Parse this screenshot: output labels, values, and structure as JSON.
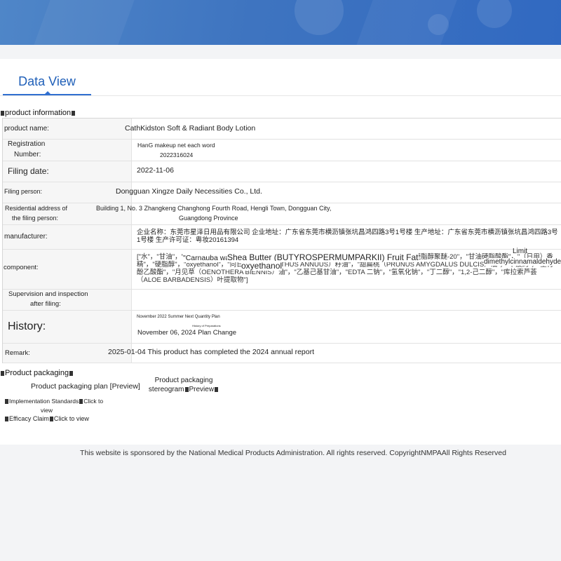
{
  "tab": {
    "label": "Data View"
  },
  "product_information": {
    "section_title": "product information",
    "fields": {
      "product_name": {
        "label": "product name:",
        "value": "CathKidston Soft & Radiant Body Lotion"
      },
      "registration_number": {
        "label_line1": "Registration",
        "label_line2": "Number:",
        "value_line1": "HanG makeup net each word",
        "value_line2": "2022316024"
      },
      "filing_date": {
        "label": "Filing date:",
        "value": "2022-11-06"
      },
      "filing_person": {
        "label": "Filing person:",
        "value": "Dongguan Xingze Daily Necessities Co., Ltd."
      },
      "residential_address": {
        "label_line1": "Residential address of",
        "label_line2": "the filing person:",
        "value_line1": "Building 1, No. 3 Zhangkeng Changhong Fourth Road, Hengli Town, Dongguan City,",
        "value_line2": "Guangdong Province"
      },
      "manufacturer": {
        "label": "manufacturer:",
        "value": "企业名称：东莞市星泽日用品有限公司 企业地址：广东省东莞市横沥镇张坑昌鸿四路3号1号楼 生产地址：广东省东莞市横沥镇张坑昌鸿四路3号1号楼 生产许可证：粤妆20161394"
      },
      "component": {
        "label": "component:",
        "value": "[\"水\"，\"甘油\"，\"Carnauba wax\"，\"Shea Butter (BUTYROSPERMUMPARKII) Fruit Fat\"，\"鲸蜡硬脂醇聚醚-20\"，\"甘油硬脂酸酯\"，\"（日用）香精\"，\"硬脂醇\"，\"oxyethanol\"，\"向日葵（HELIANTHUS ANNUUS）籽油\"，\"甜扁桃（PRUNUS AMYGDALUS DULCIS）油\"，\"卡波姆\"，\"生育酚乙酸酯\"，\"月见草（OENOTHERA BIENNIS）油\"，\"乙基己基甘油\"，\"EDTA 二钠\"，\"氢氧化钠\"，\"丁二醇\"，\"1,2-己二醇\"，\"库拉索芦荟（ALOE BARBADENSIS）叶提取物\"]",
        "overlay_carnauba": "\"Carnauba wax",
        "overlay_shea": "Shea Butter (BUTYROSPERMUMPARKII) Fruit Fat",
        "overlay_oxy": "oxyethanol",
        "overlay_limit": "Limit",
        "overlay_amyl": "amyl",
        "overlay_dimethyl": "dimethylcinnamaldehyde"
      },
      "supervision": {
        "label_line1": "Supervision and inspection",
        "label_line2": "after filing:",
        "value": ""
      },
      "history": {
        "label": "History:",
        "line1": "November 2022 Summer Next Quantity Plan",
        "line2": "History of Preparations",
        "line3": "November 06, 2024 Plan Change"
      },
      "remark": {
        "label": "Remark:",
        "value": "2025-01-04 This product has completed the 2024 annual report"
      }
    }
  },
  "product_packaging": {
    "section_title": "Product packaging",
    "plan_link": "Product packaging plan [Preview]",
    "stereogram_line1": "Product packaging",
    "stereogram_line2": "stereogram",
    "stereogram_preview": "Preview",
    "impl_standards_label": "Implementation Standards",
    "impl_standards_click": "Click to",
    "impl_standards_view": "view",
    "efficacy_label": "Efficacy Claim",
    "efficacy_click": "Click to view"
  },
  "footer": {
    "text": "This website is sponsored by the National Medical Products Administration. All rights reserved. CopyrightNMPAAll Rights Reserved"
  }
}
